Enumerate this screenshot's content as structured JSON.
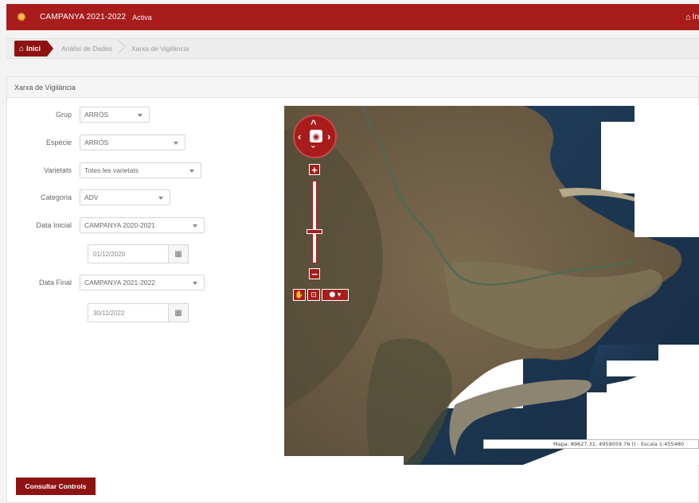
{
  "header": {
    "title": "CAMPANYA 2021-2022",
    "status": "Activa",
    "home_label": "In"
  },
  "breadcrumb": {
    "home": "Inici",
    "items": [
      "Anàlisi de Dades",
      "Xarxa de Vigilància"
    ]
  },
  "panel": {
    "title": "Xarxa de Vigilància"
  },
  "form": {
    "grup": {
      "label": "Grup",
      "value": "ARRÒS"
    },
    "especie": {
      "label": "Espècie",
      "value": "ARRÒS"
    },
    "varietats": {
      "label": "Varietats",
      "value": "Totes les varietats"
    },
    "categoria": {
      "label": "Categoria",
      "value": "ADV"
    },
    "data_inicial": {
      "label": "Data Inicial",
      "value": "CAMPANYA 2020-2021",
      "date": "01/12/2020"
    },
    "data_final": {
      "label": "Data Final",
      "value": "CAMPANYA 2021-2022",
      "date": "30/11/2022"
    },
    "submit_label": "Consultar Controls"
  },
  "map": {
    "scale_text": "Mapa: 89627.31, 4959059.76 () - Escala 1:455480",
    "zoom_level": 0.38
  },
  "colors": {
    "brand": "#a81c1c",
    "brand_dark": "#8e1212",
    "sea": "#1f3650",
    "land": "#6a5a43"
  },
  "icons": {
    "logo": "gear-logo-icon",
    "home": "home-icon",
    "calendar": "calendar-icon",
    "pan": "hand-pan-icon",
    "zoom_box": "zoom-box-icon",
    "layers": "layers-icon"
  }
}
